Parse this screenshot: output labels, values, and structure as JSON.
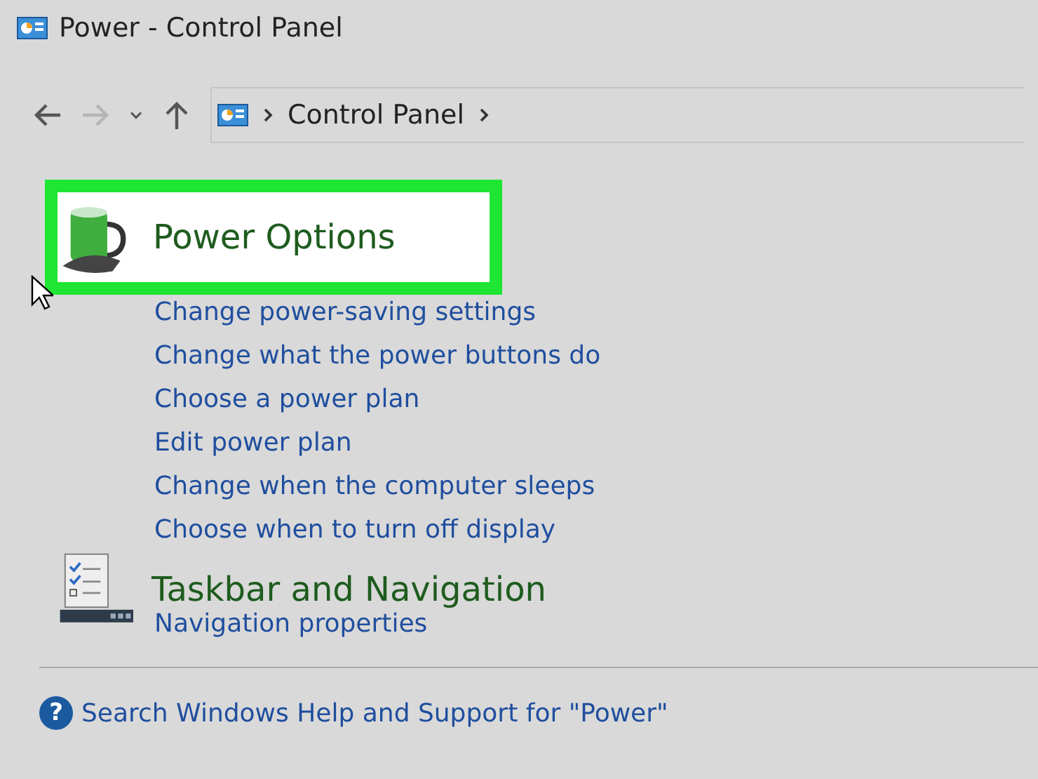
{
  "window": {
    "title": "Power - Control Panel"
  },
  "nav": {
    "buttons": [
      {
        "kind": "back",
        "disabled": false
      },
      {
        "kind": "forward",
        "disabled": true
      },
      {
        "kind": "recent",
        "disabled": false
      },
      {
        "kind": "up",
        "disabled": false
      }
    ],
    "breadcrumb": [
      "Control Panel"
    ]
  },
  "sections": [
    {
      "kind": "power",
      "title": "Power Options",
      "highlighted": true,
      "links": [
        "Change power-saving settings",
        "Change what the power buttons do",
        "Choose a power plan",
        "Edit power plan",
        "Change when the computer sleeps",
        "Choose when to turn off display"
      ]
    },
    {
      "kind": "taskbar",
      "title": "Taskbar and Navigation",
      "highlighted": false,
      "links": [
        "Navigation properties"
      ]
    }
  ],
  "help": {
    "glyph": "?",
    "text": "Search Windows Help and Support for \"Power\""
  }
}
